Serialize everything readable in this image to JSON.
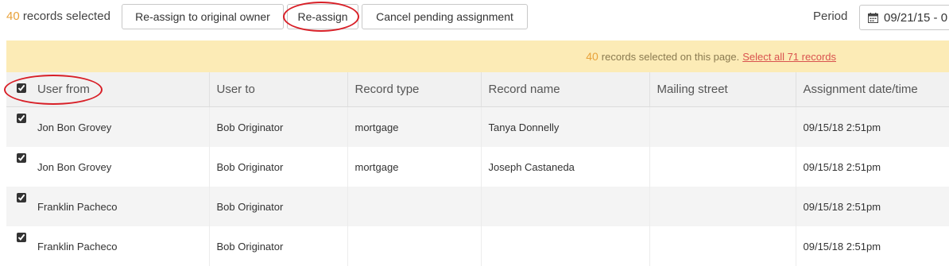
{
  "toolbar": {
    "selected_count": "40",
    "selected_label": "records selected",
    "reassign_original_label": "Re-assign to original owner",
    "reassign_label": "Re-assign",
    "cancel_pending_label": "Cancel pending assignment",
    "period_label": "Period",
    "period_value": "09/21/15 - 0"
  },
  "banner": {
    "count": "40",
    "text": "records selected on this page.",
    "select_all_link": "Select all 71 records"
  },
  "table": {
    "columns": [
      "User from",
      "User to",
      "Record type",
      "Record name",
      "Mailing street",
      "Assignment date/time"
    ],
    "rows": [
      {
        "user_from": "Jon Bon Grovey",
        "user_to": "Bob Originator",
        "record_type": "mortgage",
        "record_name": "Tanya Donnelly",
        "mailing_street": "",
        "assignment": "09/15/18 2:51pm",
        "checked": true
      },
      {
        "user_from": "Jon Bon Grovey",
        "user_to": "Bob Originator",
        "record_type": "mortgage",
        "record_name": "Joseph Castaneda",
        "mailing_street": "",
        "assignment": "09/15/18 2:51pm",
        "checked": true
      },
      {
        "user_from": "Franklin Pacheco",
        "user_to": "Bob Originator",
        "record_type": "",
        "record_name": "",
        "mailing_street": "",
        "assignment": "09/15/18 2:51pm",
        "checked": true
      },
      {
        "user_from": "Franklin Pacheco",
        "user_to": "Bob Originator",
        "record_type": "",
        "record_name": "",
        "mailing_street": "",
        "assignment": "09/15/18 2:51pm",
        "checked": true
      }
    ]
  },
  "colors": {
    "accent_orange": "#e8a23a",
    "banner_bg": "#fcebb6",
    "annotation_red": "#d81f27",
    "link_red": "#d9534f"
  },
  "icons": {
    "period": "calendar-icon",
    "header_checkbox": "checkbox-checked"
  }
}
